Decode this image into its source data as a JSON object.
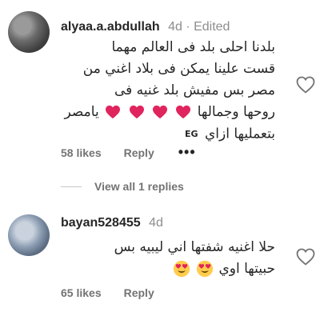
{
  "comments": [
    {
      "username": "alyaa.a.abdullah",
      "meta": "4d · Edited",
      "lines": [
        "بلدنا احلى بلد فى العالم مهما",
        "قست علينا يمكن فى بلاد اغني من",
        "مصر بس مفيش بلد غنيه فى",
        "روحها وجمالها",
        "يامصر",
        "بتعمليها ازاي"
      ],
      "flag_text": "EG",
      "likes": "58 likes",
      "reply": "Reply",
      "more": "•••",
      "view_replies": "View all 1 replies"
    },
    {
      "username": "bayan528455",
      "meta": "4d",
      "lines": [
        "حلا اغنيه شفتها اني ليبيه بس",
        "حبيتها اوي"
      ],
      "likes": "65 likes",
      "reply": "Reply"
    }
  ],
  "icons": {
    "like": "heart-outline-icon",
    "emoji_heart": "red-heart-emoji",
    "emoji_face": "heart-eyes-emoji",
    "more": "more-dots-icon"
  },
  "colors": {
    "text": "#262626",
    "muted": "#8e8e8e",
    "action": "#737373",
    "heart": "#e0245e"
  }
}
